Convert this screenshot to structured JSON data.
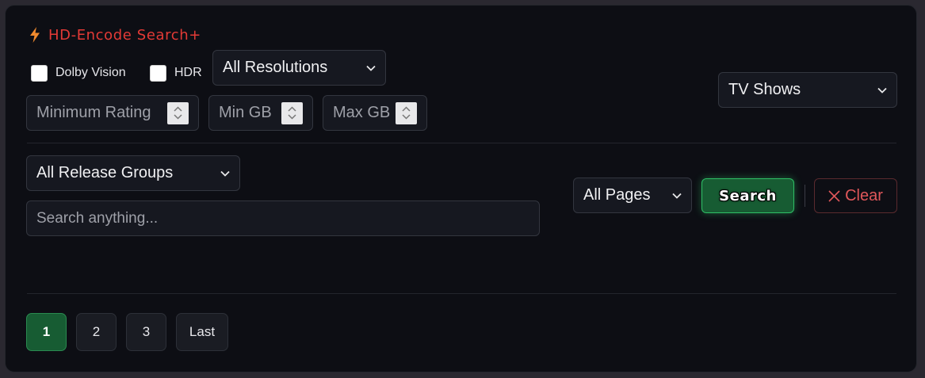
{
  "header": {
    "title": "HD-Encode Search+",
    "icon": "lightning-bolt-icon"
  },
  "filters": {
    "dolby_vision_label": "Dolby Vision",
    "dolby_vision_checked": false,
    "hdr_label": "HDR",
    "hdr_checked": false,
    "resolution_selected": "All Resolutions",
    "min_rating_placeholder": "Minimum Rating",
    "min_gb_placeholder": "Min GB",
    "max_gb_placeholder": "Max GB",
    "category_selected": "TV Shows",
    "release_group_selected": "All Release Groups",
    "search_placeholder": "Search anything...",
    "pages_selected": "All Pages"
  },
  "actions": {
    "search_label": "Search",
    "clear_label": "Clear"
  },
  "pagination": {
    "pages": [
      "1",
      "2",
      "3"
    ],
    "active_page": "1",
    "last_label": "Last"
  },
  "colors": {
    "accent_red": "#e43a36",
    "accent_green": "#175c33",
    "panel_bg": "#0d0e14",
    "clear_red": "#e0575a"
  }
}
